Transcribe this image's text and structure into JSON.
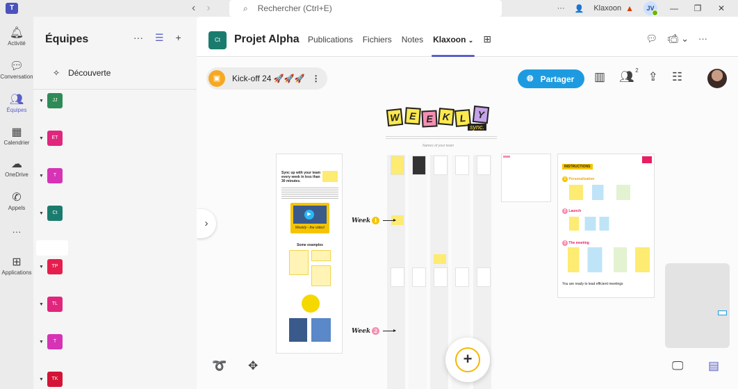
{
  "titlebar": {
    "search_placeholder": "Rechercher (Ctrl+E)",
    "org_name": "Klaxoon",
    "user_initials": "JV",
    "more_label": "···"
  },
  "rail": {
    "items": [
      {
        "label": "Activité",
        "icon": "bell-icon"
      },
      {
        "label": "Conversation",
        "icon": "chat-icon"
      },
      {
        "label": "Équipes",
        "icon": "teams-icon"
      },
      {
        "label": "Calendrier",
        "icon": "calendar-icon"
      },
      {
        "label": "OneDrive",
        "icon": "cloud-icon"
      },
      {
        "label": "Appels",
        "icon": "phone-icon"
      },
      {
        "label": "Applications",
        "icon": "apps-icon"
      }
    ],
    "more_label": "···"
  },
  "teams_panel": {
    "title": "Équipes",
    "discover_label": "Découverte",
    "teams": [
      {
        "initials": "JJ",
        "color": "#2e8b57"
      },
      {
        "initials": "ET",
        "color": "#e0267d"
      },
      {
        "initials": "T",
        "color": "#d633b5"
      },
      {
        "initials": "Ct",
        "color": "#1a7c6e"
      },
      {
        "initials": "TP",
        "color": "#e61e4d"
      },
      {
        "initials": "TL",
        "color": "#e0267d"
      },
      {
        "initials": "T",
        "color": "#d633b5"
      },
      {
        "initials": "TK",
        "color": "#d31436"
      }
    ]
  },
  "channel": {
    "avatar": "Ct",
    "title": "Projet Alpha",
    "tabs": [
      {
        "label": "Publications"
      },
      {
        "label": "Fichiers"
      },
      {
        "label": "Notes"
      },
      {
        "label": "Klaxoon"
      }
    ],
    "active_tab": "Klaxoon"
  },
  "board": {
    "name": "Kick-off 24 🚀🚀🚀",
    "share_label": "Partager",
    "participants_count": "2",
    "title_letters": [
      "W",
      "E",
      "E",
      "K",
      "L",
      "Y"
    ],
    "title_sub": "sync.",
    "names_label": "Names of your team",
    "week_label": "Week",
    "week_numbers": [
      "1",
      "2"
    ],
    "section_left": {
      "heading": "Sync up with your team every week in less than 30 minutes.",
      "video_label": "Weekly - the video!",
      "examples_label": "Some examples"
    },
    "section_right": {
      "badge": "INSTRUCTIONS",
      "steps": [
        "Personalization",
        "Launch",
        "The meeting"
      ],
      "footer": "You are ready to lead efficient meetings"
    }
  }
}
